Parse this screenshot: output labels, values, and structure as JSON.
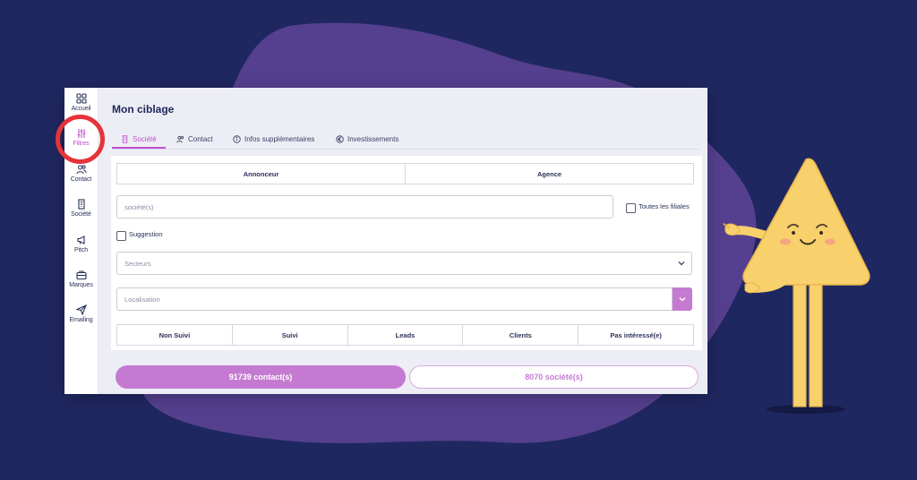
{
  "page": {
    "title": "Mon ciblage"
  },
  "colors": {
    "background": "#1f2760",
    "blob": "#55408f",
    "accent": "#c04fd0",
    "accent_soft": "#c57ad2",
    "highlight_ring": "#e6333a",
    "mascot": "#f8d06c"
  },
  "sidebar": {
    "items": [
      {
        "label": "Accueil",
        "icon": "grid-icon",
        "active": false
      },
      {
        "label": "Filtres",
        "icon": "sliders-icon",
        "active": true
      },
      {
        "label": "Contact",
        "icon": "users-icon",
        "active": false
      },
      {
        "label": "Société",
        "icon": "building-icon",
        "active": false
      },
      {
        "label": "Pitch",
        "icon": "megaphone-icon",
        "active": false
      },
      {
        "label": "Marques",
        "icon": "briefcase-icon",
        "active": false
      },
      {
        "label": "Emailing",
        "icon": "send-icon",
        "active": false
      }
    ]
  },
  "tabs": [
    {
      "label": "Société",
      "icon": "building-icon",
      "active": true
    },
    {
      "label": "Contact",
      "icon": "users-icon",
      "active": false
    },
    {
      "label": "Infos supplémentaires",
      "icon": "info-icon",
      "active": false
    },
    {
      "label": "Investissements",
      "icon": "euro-icon",
      "active": false
    }
  ],
  "filters": {
    "type_toggle": [
      "Annonceur",
      "Agence"
    ],
    "company_input": {
      "placeholder": "société(s)"
    },
    "subsidiaries_checkbox": {
      "label": "Toutes les filiales",
      "checked": false
    },
    "suggestion_checkbox": {
      "label": "Suggestion",
      "checked": false
    },
    "sectors_select": {
      "placeholder": "Secteurs"
    },
    "location_select": {
      "placeholder": "Localisation"
    },
    "status_toggle": [
      "Non Suivi",
      "Suivi",
      "Leads",
      "Clients",
      "Pas intéressé(e)"
    ]
  },
  "results": {
    "contacts_label": "91739 contact(s)",
    "companies_label": "8070 société(s)"
  }
}
